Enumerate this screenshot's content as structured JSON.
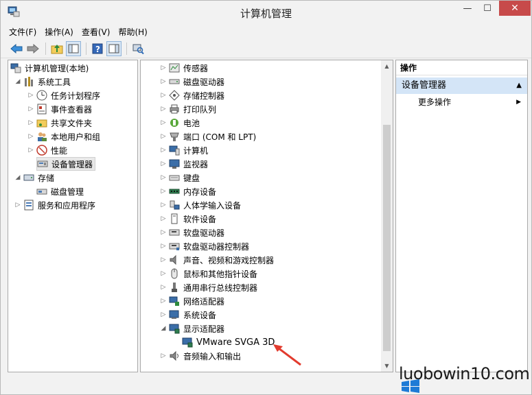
{
  "window": {
    "title": "计算机管理"
  },
  "menubar": {
    "items": [
      "文件(F)",
      "操作(A)",
      "查看(V)",
      "帮助(H)"
    ]
  },
  "left_tree": {
    "items": [
      {
        "label": "计算机管理(本地)",
        "depth": 0,
        "arrow": "",
        "icon": "computer-management-icon"
      },
      {
        "label": "系统工具",
        "depth": 1,
        "arrow": "◢",
        "icon": "tools-icon"
      },
      {
        "label": "任务计划程序",
        "depth": 2,
        "arrow": "▷",
        "icon": "clock-icon"
      },
      {
        "label": "事件查看器",
        "depth": 2,
        "arrow": "▷",
        "icon": "event-viewer-icon"
      },
      {
        "label": "共享文件夹",
        "depth": 2,
        "arrow": "▷",
        "icon": "shared-folder-icon"
      },
      {
        "label": "本地用户和组",
        "depth": 2,
        "arrow": "▷",
        "icon": "users-icon"
      },
      {
        "label": "性能",
        "depth": 2,
        "arrow": "▷",
        "icon": "performance-icon"
      },
      {
        "label": "设备管理器",
        "depth": 2,
        "arrow": "",
        "icon": "device-manager-icon",
        "selected": true
      },
      {
        "label": "存储",
        "depth": 1,
        "arrow": "◢",
        "icon": "storage-icon"
      },
      {
        "label": "磁盘管理",
        "depth": 2,
        "arrow": "",
        "icon": "disk-management-icon"
      },
      {
        "label": "服务和应用程序",
        "depth": 1,
        "arrow": "▷",
        "icon": "services-icon"
      }
    ]
  },
  "device_tree": {
    "items": [
      {
        "label": "传感器",
        "arrow": "▷",
        "icon": "sensor-icon",
        "depth": 0
      },
      {
        "label": "磁盘驱动器",
        "arrow": "▷",
        "icon": "disk-drive-icon",
        "depth": 0
      },
      {
        "label": "存储控制器",
        "arrow": "▷",
        "icon": "storage-controller-icon",
        "depth": 0
      },
      {
        "label": "打印队列",
        "arrow": "▷",
        "icon": "printer-icon",
        "depth": 0
      },
      {
        "label": "电池",
        "arrow": "▷",
        "icon": "battery-icon",
        "depth": 0
      },
      {
        "label": "端口 (COM 和 LPT)",
        "arrow": "▷",
        "icon": "port-icon",
        "depth": 0
      },
      {
        "label": "计算机",
        "arrow": "▷",
        "icon": "computer-icon",
        "depth": 0
      },
      {
        "label": "监视器",
        "arrow": "▷",
        "icon": "monitor-icon",
        "depth": 0
      },
      {
        "label": "键盘",
        "arrow": "▷",
        "icon": "keyboard-icon",
        "depth": 0
      },
      {
        "label": "内存设备",
        "arrow": "▷",
        "icon": "memory-icon",
        "depth": 0
      },
      {
        "label": "人体学输入设备",
        "arrow": "▷",
        "icon": "hid-icon",
        "depth": 0
      },
      {
        "label": "软件设备",
        "arrow": "▷",
        "icon": "software-device-icon",
        "depth": 0
      },
      {
        "label": "软盘驱动器",
        "arrow": "▷",
        "icon": "floppy-drive-icon",
        "depth": 0
      },
      {
        "label": "软盘驱动器控制器",
        "arrow": "▷",
        "icon": "floppy-controller-icon",
        "depth": 0
      },
      {
        "label": "声音、视频和游戏控制器",
        "arrow": "▷",
        "icon": "sound-icon",
        "depth": 0
      },
      {
        "label": "鼠标和其他指针设备",
        "arrow": "▷",
        "icon": "mouse-icon",
        "depth": 0
      },
      {
        "label": "通用串行总线控制器",
        "arrow": "▷",
        "icon": "usb-icon",
        "depth": 0
      },
      {
        "label": "网络适配器",
        "arrow": "▷",
        "icon": "network-adapter-icon",
        "depth": 0
      },
      {
        "label": "系统设备",
        "arrow": "▷",
        "icon": "system-device-icon",
        "depth": 0
      },
      {
        "label": "显示适配器",
        "arrow": "◢",
        "icon": "display-adapter-icon",
        "depth": 0
      },
      {
        "label": "VMware SVGA 3D",
        "arrow": "",
        "icon": "display-adapter-icon",
        "depth": 1
      },
      {
        "label": "音频输入和输出",
        "arrow": "▷",
        "icon": "audio-icon",
        "depth": 0
      }
    ]
  },
  "actions": {
    "header": "操作",
    "section_title": "设备管理器",
    "more": "更多操作"
  },
  "watermark": "luobowin10.com",
  "colors": {
    "selection": "#d4e5f7",
    "close": "#c74a4a",
    "arrow_red": "#e23b2e"
  }
}
